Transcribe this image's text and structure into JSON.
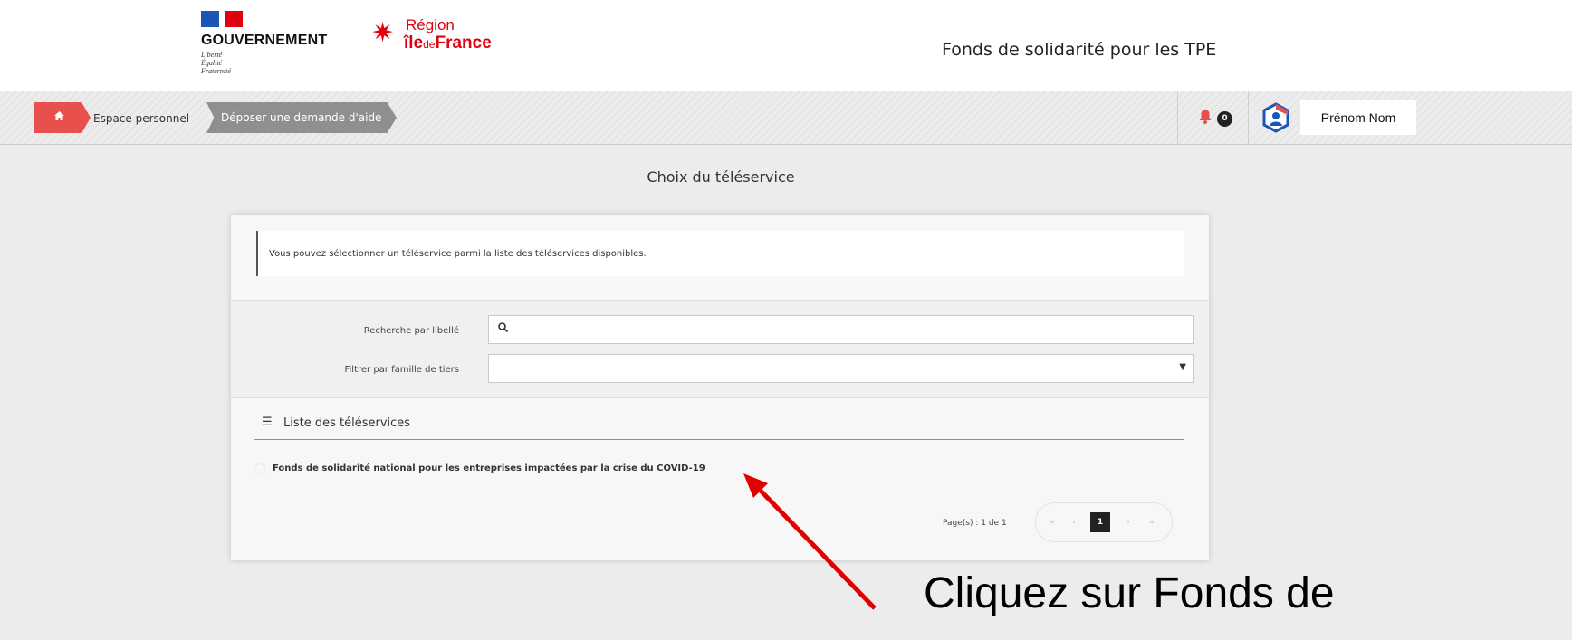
{
  "header": {
    "government": {
      "name": "GOUVERNEMENT",
      "motto": [
        "Liberté",
        "Égalité",
        "Fraternité"
      ]
    },
    "region": {
      "line1": "Région",
      "line2_a": "île",
      "line2_b": "de",
      "line2_c": "France"
    },
    "app_title": "Fonds de solidarité pour les TPE"
  },
  "breadcrumb": {
    "home_icon": "home-icon",
    "personal_space": "Espace personnel",
    "current": "Déposer une demande d'aide"
  },
  "notifications": {
    "icon": "bell-icon",
    "count": "0"
  },
  "user": {
    "name": "Prénom Nom",
    "avatar_icon": "user-shield-icon"
  },
  "main": {
    "title": "Choix du téléservice",
    "info": "Vous pouvez sélectionner un téléservice parmi la liste des téléservices disponibles.",
    "filters": {
      "search_label": "Recherche par libellé",
      "search_value": "",
      "family_label": "Filtrer par famille de tiers",
      "family_value": ""
    },
    "list": {
      "title": "Liste des téléservices",
      "items": [
        "Fonds de solidarité national pour les entreprises impactées par la crise du COVID-19"
      ]
    },
    "pagination": {
      "label": "Page(s) : 1 de 1",
      "first": "«",
      "prev": "‹",
      "current": "1",
      "next": "›",
      "last": "»"
    }
  },
  "annotation": {
    "text": "Cliquez sur Fonds de"
  },
  "colors": {
    "accent_red": "#e8504d",
    "breadcrumb_grey": "#8f8f8f",
    "region_red": "#e1000f",
    "flag_blue": "#1a56b8",
    "arrow_red": "#e00000"
  }
}
